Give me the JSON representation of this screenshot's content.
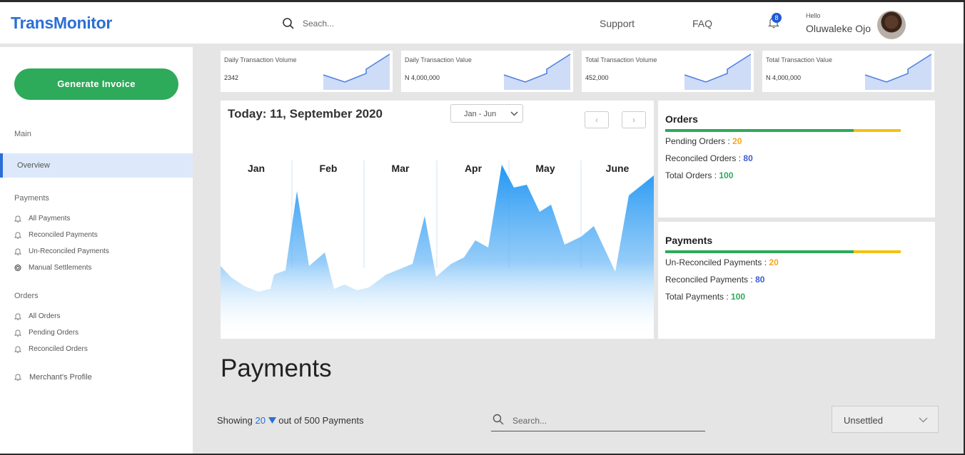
{
  "header": {
    "logo": "TransMonitor",
    "search_placeholder": "Seach...",
    "nav": [
      "Support",
      "FAQ"
    ],
    "notification_count": "8",
    "greeting": "Hello",
    "user_name": "Oluwaleke Ojo"
  },
  "sidebar": {
    "generate_invoice": "Generate Invoice",
    "main_label": "Main",
    "overview": "Overview",
    "payments_label": "Payments",
    "payments_items": [
      "All Payments",
      "Reconciled Payments",
      "Un-Reconciled Payments",
      "Manual Settlements"
    ],
    "orders_label": "Orders",
    "orders_items": [
      "All Orders",
      "Pending Orders",
      "Reconciled Orders"
    ],
    "merchant_profile": "Merchant's Profile"
  },
  "stats": [
    {
      "title": "Daily Transaction Volume",
      "value": "2342"
    },
    {
      "title": "Daily Transaction Value",
      "value": "N 4,000,000"
    },
    {
      "title": "Total Transaction Volume",
      "value": "452,000"
    },
    {
      "title": "Total Transaction Value",
      "value": "N 4,000,000"
    }
  ],
  "overview_chart": {
    "title": "Today: 11, September 2020",
    "range": "Jan - Jun",
    "prev": "‹",
    "next": "›",
    "months": [
      "Jan",
      "Feb",
      "Mar",
      "Apr",
      "May",
      "June"
    ]
  },
  "orders_panel": {
    "title": "Orders",
    "pending_label": "Pending Orders : ",
    "pending": "20",
    "reconciled_label": "Reconciled Orders : ",
    "reconciled": "80",
    "total_label": "Total Orders : ",
    "total": "100"
  },
  "payments_panel": {
    "title": "Payments",
    "unreconciled_label": "Un-Reconciled Payments : ",
    "unreconciled": "20",
    "reconciled_label": "Reconciled Payments : ",
    "reconciled": "80",
    "total_label": "Total Payments : ",
    "total": "100"
  },
  "payments_section": {
    "title": "Payments",
    "showing_prefix": "Showing",
    "showing_count": "20",
    "showing_suffix": "out of 500 Payments",
    "search_placeholder": "Search...",
    "status_filter": "Unsettled"
  },
  "colors": {
    "brand": "#2b6fd6",
    "primary_button": "#2daa5a",
    "warning": "#f5c211",
    "chart_fill": "#2196f3"
  }
}
